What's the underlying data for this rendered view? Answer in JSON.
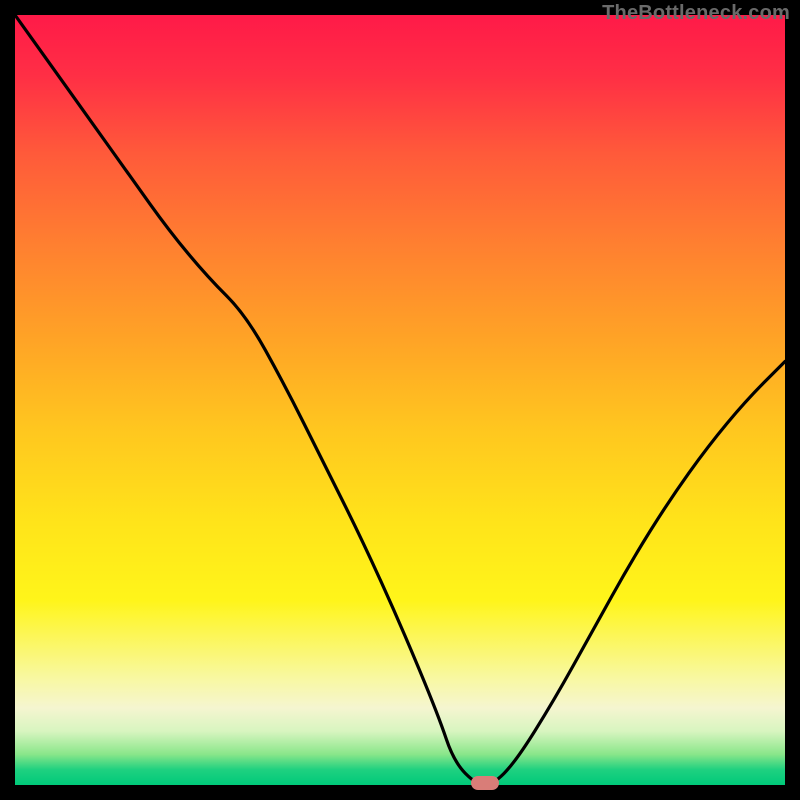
{
  "watermark": "TheBottleneck.com",
  "chart_data": {
    "type": "line",
    "title": "",
    "xlabel": "",
    "ylabel": "",
    "xlim": [
      0,
      100
    ],
    "ylim": [
      0,
      100
    ],
    "grid": false,
    "legend": false,
    "background": {
      "gradient": "vertical",
      "stops": [
        {
          "pos": 0,
          "color": "#ff1a48"
        },
        {
          "pos": 50,
          "color": "#ffd41f"
        },
        {
          "pos": 90,
          "color": "#f5f5d0"
        },
        {
          "pos": 100,
          "color": "#00c97a"
        }
      ],
      "meaning": "top=high bottleneck, bottom=optimal"
    },
    "series": [
      {
        "name": "bottleneck-curve",
        "color": "#000000",
        "x": [
          0,
          5,
          10,
          15,
          20,
          25,
          30,
          35,
          40,
          45,
          50,
          55,
          57,
          60,
          62,
          65,
          70,
          75,
          80,
          85,
          90,
          95,
          100
        ],
        "y": [
          100,
          93,
          86,
          79,
          72,
          66,
          61,
          52,
          42,
          32,
          21,
          9,
          3,
          0,
          0,
          3,
          11,
          20,
          29,
          37,
          44,
          50,
          55
        ]
      }
    ],
    "annotations": [
      {
        "name": "optimal-point-marker",
        "x": 61,
        "y": 0,
        "shape": "pill",
        "color": "#d97d78"
      }
    ]
  }
}
